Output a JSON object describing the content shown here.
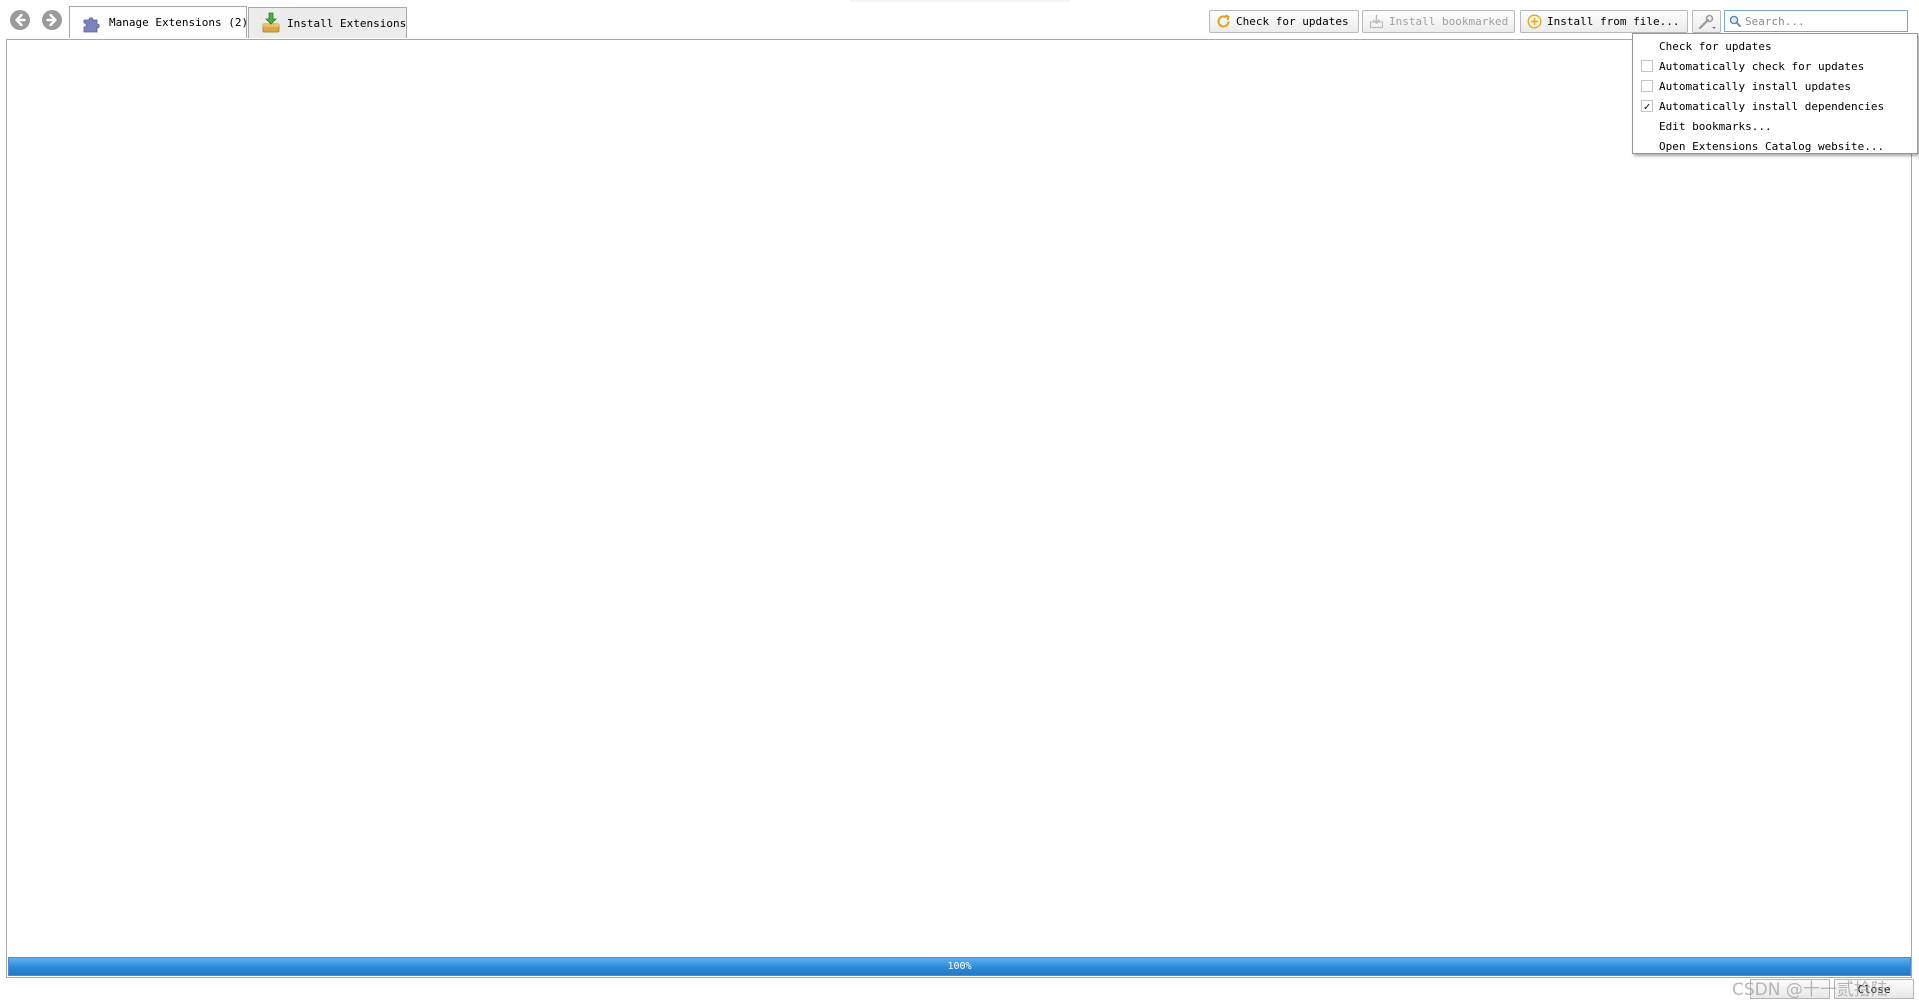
{
  "nav": {
    "back_icon": "back-arrow-icon",
    "forward_icon": "forward-arrow-icon"
  },
  "tabs": [
    {
      "label": "Manage Extensions (2)",
      "icon": "puzzle-icon",
      "active": true
    },
    {
      "label": "Install Extensions",
      "icon": "download-box-icon",
      "active": false
    }
  ],
  "toolbar": {
    "check_updates_label": "Check for updates",
    "install_bookmarked_label": "Install bookmarked",
    "install_from_file_label": "Install from file...",
    "options_icon": "wrench-icon",
    "search_placeholder": "Search..."
  },
  "options_menu": {
    "items": [
      {
        "label": "Check for updates",
        "checkbox": false
      },
      {
        "label": "Automatically check for updates",
        "checkbox": true,
        "checked": false
      },
      {
        "label": "Automatically install updates",
        "checkbox": true,
        "checked": false
      },
      {
        "label": "Automatically install dependencies",
        "checkbox": true,
        "checked": true
      },
      {
        "label": "Edit bookmarks...",
        "checkbox": false
      },
      {
        "label": "Open Extensions Catalog website...",
        "checkbox": false
      }
    ]
  },
  "progress": {
    "value": 1.0,
    "label": "100%"
  },
  "footer": {
    "close_label": "Close"
  },
  "watermark": "CSDN @十一贰拾陆",
  "colors": {
    "progress_fill": "#2c8ad8",
    "search_border": "#7aa6d6"
  }
}
